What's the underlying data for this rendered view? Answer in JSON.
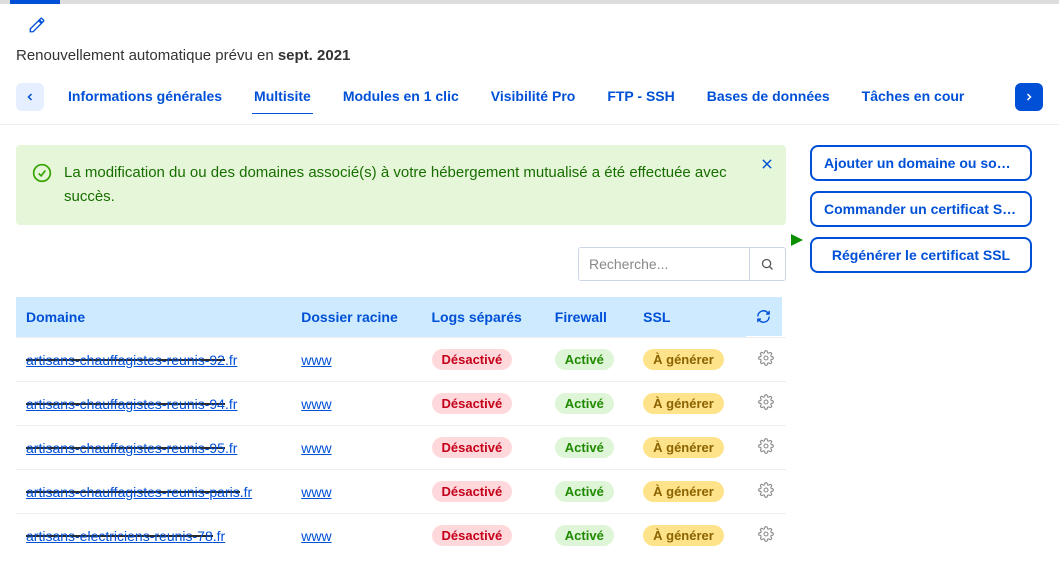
{
  "subtitle_prefix": "Renouvellement automatique prévu en ",
  "subtitle_date": "sept. 2021",
  "tabs": {
    "items": [
      {
        "label": "Informations générales",
        "active": false
      },
      {
        "label": "Multisite",
        "active": true
      },
      {
        "label": "Modules en 1 clic",
        "active": false
      },
      {
        "label": "Visibilité Pro",
        "active": false
      },
      {
        "label": "FTP - SSH",
        "active": false
      },
      {
        "label": "Bases de données",
        "active": false
      },
      {
        "label": "Tâches en cour",
        "active": false
      }
    ]
  },
  "alert": {
    "message": "La modification du ou des domaines associé(s) à votre hébergement mutualisé a été effectuée avec succès."
  },
  "search": {
    "placeholder": "Recherche..."
  },
  "table": {
    "headers": {
      "domain": "Domaine",
      "root": "Dossier racine",
      "logs": "Logs séparés",
      "firewall": "Firewall",
      "ssl": "SSL"
    },
    "rows": [
      {
        "domain_masked": "artisans-chauffagistes-reunis-92",
        "domain_tail": ".fr",
        "root": "www",
        "logs": "Désactivé",
        "firewall": "Activé",
        "ssl": "À générer"
      },
      {
        "domain_masked": "artisans-chauffagistes-reunis-94",
        "domain_tail": ".fr",
        "root": "www",
        "logs": "Désactivé",
        "firewall": "Activé",
        "ssl": "À générer"
      },
      {
        "domain_masked": "artisans-chauffagistes-reunis-95",
        "domain_tail": ".fr",
        "root": "www",
        "logs": "Désactivé",
        "firewall": "Activé",
        "ssl": "À générer"
      },
      {
        "domain_masked": "artisans-chauffagistes-reunis-paris",
        "domain_tail": ".fr",
        "root": "www",
        "logs": "Désactivé",
        "firewall": "Activé",
        "ssl": "À générer"
      },
      {
        "domain_masked": "artisans-electriciens-reunis-78",
        "domain_tail": ".fr",
        "root": "www",
        "logs": "Désactivé",
        "firewall": "Activé",
        "ssl": "À générer"
      }
    ]
  },
  "actions": {
    "add_domain": "Ajouter un domaine ou sous …",
    "order_ssl": "Commander un certificat SSL",
    "regen_ssl": "Régénérer le certificat SSL"
  }
}
